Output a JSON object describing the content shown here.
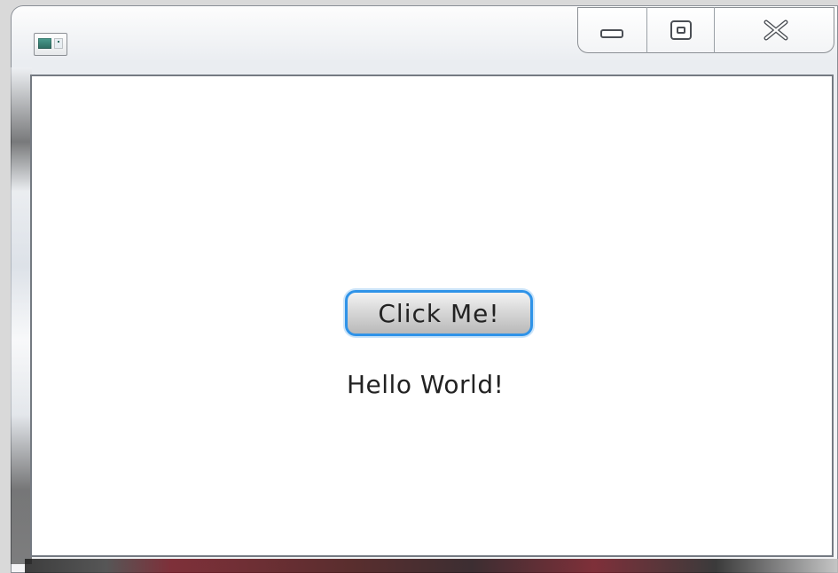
{
  "window": {
    "title": "",
    "caption_buttons": {
      "minimize_icon": "minimize-icon",
      "maximize_icon": "maximize-icon",
      "close_icon": "close-icon"
    },
    "app_icon": "window-icon"
  },
  "content": {
    "button_label": "Click Me!",
    "label_text": "Hello World!"
  },
  "colors": {
    "focus_ring": "#2f93e8",
    "text": "#222222"
  }
}
